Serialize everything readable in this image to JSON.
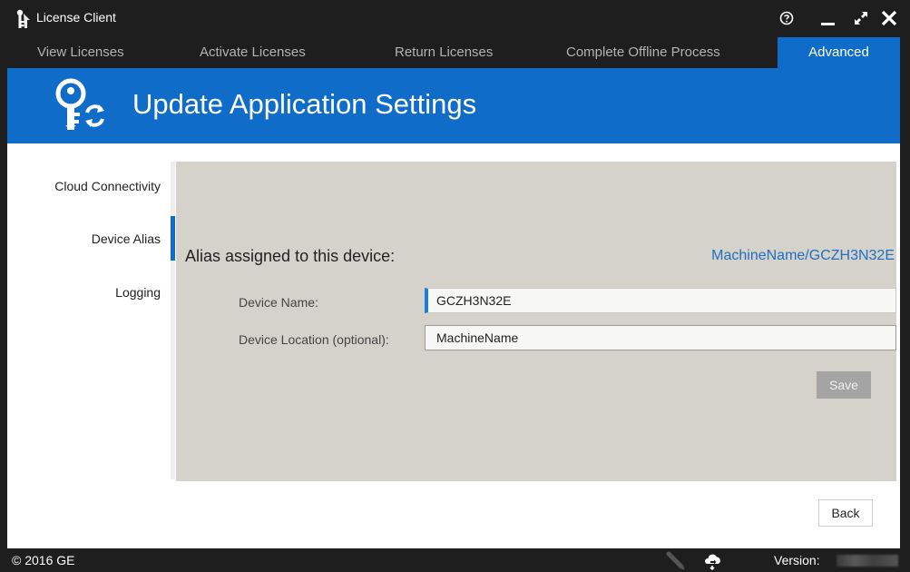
{
  "window": {
    "title": "License Client",
    "logo_icon": "license-client-logo-icon",
    "controls": {
      "help": "help-icon",
      "minimize": "minimize-icon",
      "maximize": "maximize-icon",
      "close": "close-icon"
    }
  },
  "tabs": [
    {
      "label": "View Licenses",
      "active": false
    },
    {
      "label": "Activate Licenses",
      "active": false
    },
    {
      "label": "Return Licenses",
      "active": false
    },
    {
      "label": "Complete Offline Process",
      "active": false
    },
    {
      "label": "Advanced",
      "active": true
    }
  ],
  "header": {
    "title": "Update Application Settings",
    "icon": "key-refresh-icon"
  },
  "sidenav": {
    "items": [
      {
        "label": "Cloud Connectivity",
        "selected": false
      },
      {
        "label": "Device Alias",
        "selected": true
      },
      {
        "label": "Logging",
        "selected": false
      }
    ]
  },
  "alias": {
    "heading": "Alias assigned to this device:",
    "value": "MachineName/GCZH3N32E",
    "device_name": {
      "label": "Device Name:",
      "value": "GCZH3N32E"
    },
    "device_location": {
      "label": "Device Location (optional):",
      "value": "MachineName"
    },
    "save_label": "Save"
  },
  "footer": {
    "back_label": "Back"
  },
  "status": {
    "copyright": "© 2016 GE",
    "version_label": "Version:",
    "icons": [
      "connection-plug-icon",
      "cloud-sync-icon"
    ]
  },
  "colors": {
    "accent": "#0f6cc9",
    "frame": "#1e1e1e",
    "panel": "#d4d2cb",
    "link": "#1f6fc2"
  }
}
